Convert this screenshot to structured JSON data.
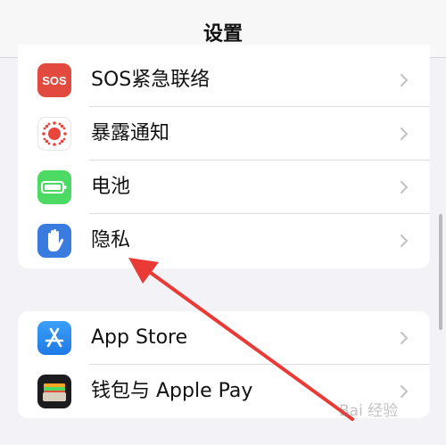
{
  "navbar": {
    "title": "设置"
  },
  "group1": {
    "rows": [
      {
        "label": "SOS紧急联络",
        "icon": "sos-icon",
        "icon_text": "SOS",
        "icon_color": "#e24a40"
      },
      {
        "label": "暴露通知",
        "icon": "exposure-notification-icon",
        "icon_color": "#ffffff"
      },
      {
        "label": "电池",
        "icon": "battery-icon",
        "icon_color": "#4cd964"
      },
      {
        "label": "隐私",
        "icon": "privacy-hand-icon",
        "icon_color": "#3a7be0"
      }
    ]
  },
  "group2": {
    "rows": [
      {
        "label": "App Store",
        "icon": "app-store-icon",
        "icon_color": "#2a8ef4"
      },
      {
        "label": "钱包与 Apple Pay",
        "icon": "wallet-icon",
        "icon_color": "#1c1c1e"
      }
    ]
  },
  "watermark": {
    "text": "Bai 经验"
  },
  "colors": {
    "arrow": "#ea3a36",
    "background": "#f2f2f7"
  }
}
